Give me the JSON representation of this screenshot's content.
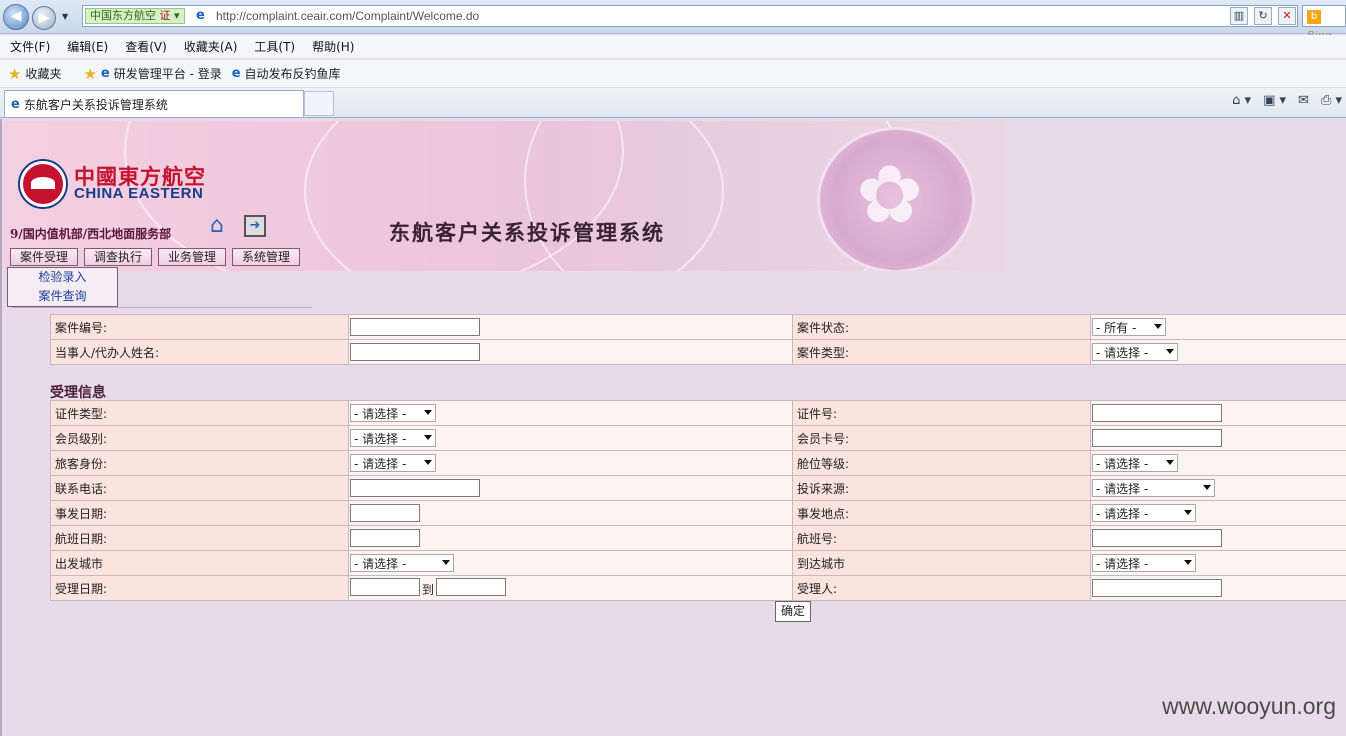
{
  "browser": {
    "site_identity": "中国东方航空",
    "site_badge": "证",
    "url": "http://complaint.ceair.com/Complaint/Welcome.do",
    "search_provider": "Bing",
    "menu": [
      "文件(F)",
      "编辑(E)",
      "查看(V)",
      "收藏夹(A)",
      "工具(T)",
      "帮助(H)"
    ],
    "favorites_label": "收藏夹",
    "favorites": [
      "研发管理平台 - 登录",
      "自动发布反钓鱼库"
    ],
    "tab_title": "东航客户关系投诉管理系统"
  },
  "header": {
    "logo_cn": "中國東方航空",
    "logo_en": "CHINA EASTERN",
    "dept": "9/国内值机部/西北地面服务部",
    "system_title": "东航客户关系投诉管理系统",
    "nav_tabs": [
      "案件受理",
      "调查执行",
      "业务管理",
      "系统管理"
    ],
    "submenu": [
      "检验录入",
      "案件查询"
    ]
  },
  "search_form": {
    "case_no_label": "案件编号:",
    "case_status_label": "案件状态:",
    "case_status_value": "- 所有 -",
    "party_name_label": "当事人/代办人姓名:",
    "case_type_label": "案件类型:",
    "case_type_value": "- 请选择 -"
  },
  "accept_section": {
    "title": "受理信息",
    "id_type_label": "证件类型:",
    "id_type_value": "- 请选择 -",
    "id_no_label": "证件号:",
    "member_level_label": "会员级别:",
    "member_level_value": "- 请选择 -",
    "member_card_label": "会员卡号:",
    "passenger_type_label": "旅客身份:",
    "passenger_type_value": "- 请选择 -",
    "cabin_class_label": "舱位等级:",
    "cabin_class_value": "- 请选择 -",
    "phone_label": "联系电话:",
    "complaint_source_label": "投诉来源:",
    "complaint_source_value": "- 请选择 -",
    "incident_date_label": "事发日期:",
    "incident_place_label": "事发地点:",
    "incident_place_value": "- 请选择 -",
    "flight_date_label": "航班日期:",
    "flight_no_label": "航班号:",
    "dep_city_label": "出发城市",
    "dep_city_value": "- 请选择 -",
    "arr_city_label": "到达城市",
    "arr_city_value": "- 请选择 -",
    "accept_date_label": "受理日期:",
    "to_label": "到",
    "accepter_label": "受理人:",
    "submit_label": "确定"
  },
  "watermark": "www.wooyun.org"
}
